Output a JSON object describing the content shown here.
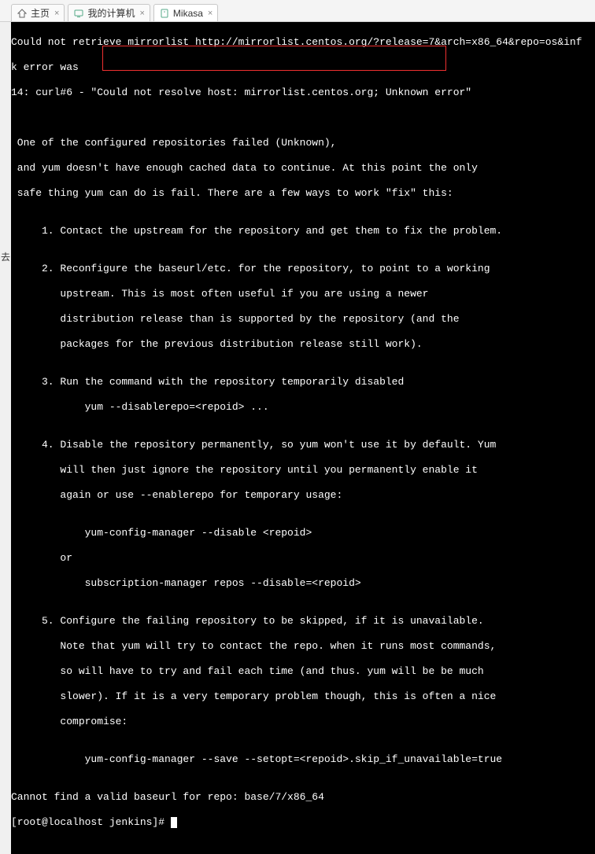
{
  "tabs": [
    {
      "label": "主页",
      "icon": "home-icon",
      "active": false
    },
    {
      "label": "我的计算机",
      "icon": "computer-icon",
      "active": false
    },
    {
      "label": "Mikasa",
      "icon": "server-icon",
      "active": true
    }
  ],
  "left_label": "去",
  "terminal": {
    "l01": "Could not retrieve mirrorlist http://mirrorlist.centos.org/?release=7&arch=x86_64&repo=os&inf",
    "l02": "k error was",
    "l03": "14: curl#6 - \"Could not resolve host: mirrorlist.centos.org; Unknown error\"",
    "l04": "",
    "l05": "",
    "l06": " One of the configured repositories failed (Unknown),",
    "l07": " and yum doesn't have enough cached data to continue. At this point the only",
    "l08": " safe thing yum can do is fail. There are a few ways to work \"fix\" this:",
    "l09": "",
    "l10": "     1. Contact the upstream for the repository and get them to fix the problem.",
    "l11": "",
    "l12": "     2. Reconfigure the baseurl/etc. for the repository, to point to a working",
    "l13": "        upstream. This is most often useful if you are using a newer",
    "l14": "        distribution release than is supported by the repository (and the",
    "l15": "        packages for the previous distribution release still work).",
    "l16": "",
    "l17": "     3. Run the command with the repository temporarily disabled",
    "l18": "            yum --disablerepo=<repoid> ...",
    "l19": "",
    "l20": "     4. Disable the repository permanently, so yum won't use it by default. Yum",
    "l21": "        will then just ignore the repository until you permanently enable it",
    "l22": "        again or use --enablerepo for temporary usage:",
    "l23": "",
    "l24": "            yum-config-manager --disable <repoid>",
    "l25": "        or",
    "l26": "            subscription-manager repos --disable=<repoid>",
    "l27": "",
    "l28": "     5. Configure the failing repository to be skipped, if it is unavailable.",
    "l29": "        Note that yum will try to contact the repo. when it runs most commands,",
    "l30": "        so will have to try and fail each time (and thus. yum will be be much",
    "l31": "        slower). If it is a very temporary problem though, this is often a nice",
    "l32": "        compromise:",
    "l33": "",
    "l34": "            yum-config-manager --save --setopt=<repoid>.skip_if_unavailable=true",
    "l35": "",
    "l36": "Cannot find a valid baseurl for repo: base/7/x86_64",
    "l37": "[root@localhost jenkins]#"
  }
}
